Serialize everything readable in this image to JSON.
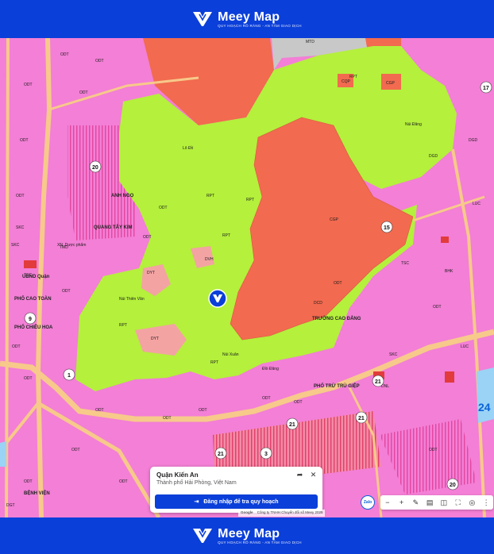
{
  "brand": {
    "name": "Meey Map",
    "tagline": "QUY HOẠCH RÕ RÀNG - AN TÂM GIAO DỊCH"
  },
  "map": {
    "places": {
      "anh_ngo": "ANH NGỌ",
      "lo_thai_vin": "Núi Thiên Văn",
      "lo_xuan": "Núi Xuân",
      "doi_dang": "Đồi Đăng",
      "xn_duoc_pham": "XN. Dược phẩm",
      "ubnd": "UBND Quận",
      "pho_cao_toan": "PHỐ CAO TOÀN",
      "pho_chieu_hoa": "PHỐ CHIÊU HOA",
      "quang_tay": "QUANG TÂY KIM",
      "pho_tru_tru": "PHỐ TRỪ TRÙ GIỆP",
      "truong_cao_dang": "TRƯỜNG CAO ĐẲNG",
      "mtd": "MTD",
      "bon_vinh": "BỆNH VIỆN",
      "lo_do": "Lô Đồ",
      "nui_dang": "Núi Đăng"
    },
    "zones": {
      "odt": "ODT",
      "rpt": "RPT",
      "cgp": "CGP",
      "skc": "SKC",
      "dgd": "DGD",
      "tsc": "TSC",
      "luc": "LUC",
      "dyt": "DYT",
      "cqp": "CQP",
      "dcd": "DCD",
      "bhk": "BHK",
      "dnl": "DNL",
      "tmd": "TMD",
      "dvh": "DVH",
      "dgt": "DGT"
    },
    "numbers": [
      "20",
      "15",
      "9",
      "1",
      "21",
      "21",
      "21",
      "21",
      "3",
      "20",
      "17",
      "24"
    ]
  },
  "info_card": {
    "title": "Quận Kiến An",
    "subtitle": "Thành phố Hải Phòng, Việt Nam",
    "login_label": "Đăng nhập để tra quy hoạch"
  },
  "zalo": {
    "label": "Zalo"
  },
  "attribution": {
    "provider": "Google",
    "text": "Công ty TNHH Chuyển đổi số Meey 2025"
  },
  "colors": {
    "brand": "#0b3fd9",
    "residential": "#f37fd6",
    "forest": "#b4f03c",
    "protected": "#f26a4f",
    "road": "#f7c98a",
    "commercial": "#f4a3a3"
  }
}
